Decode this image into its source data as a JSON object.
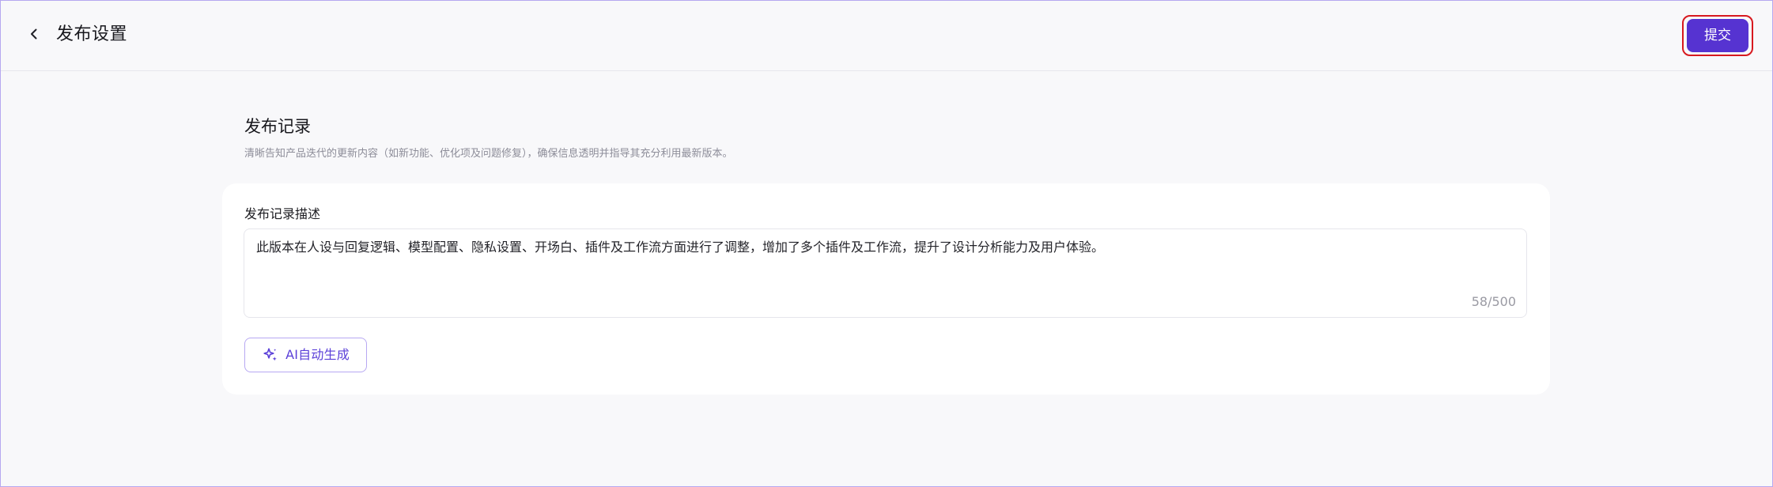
{
  "header": {
    "back_icon": "chevron-left-icon",
    "title": "发布设置",
    "submit_label": "提交",
    "submit_color": "#5633d1",
    "submit_focus_outline_color": "#d7191f"
  },
  "section": {
    "title": "发布记录",
    "description": "清晰告知产品迭代的更新内容（如新功能、优化项及问题修复），确保信息透明并指导其充分利用最新版本。"
  },
  "form": {
    "field_label": "发布记录描述",
    "textarea_value": "此版本在人设与回复逻辑、模型配置、隐私设置、开场白、插件及工作流方面进行了调整，增加了多个插件及工作流，提升了设计分析能力及用户体验。",
    "counter": "58/500",
    "ai_button_icon": "sparkles-icon",
    "ai_button_label": "AI自动生成",
    "ai_button_color": "#5a3fd8"
  }
}
